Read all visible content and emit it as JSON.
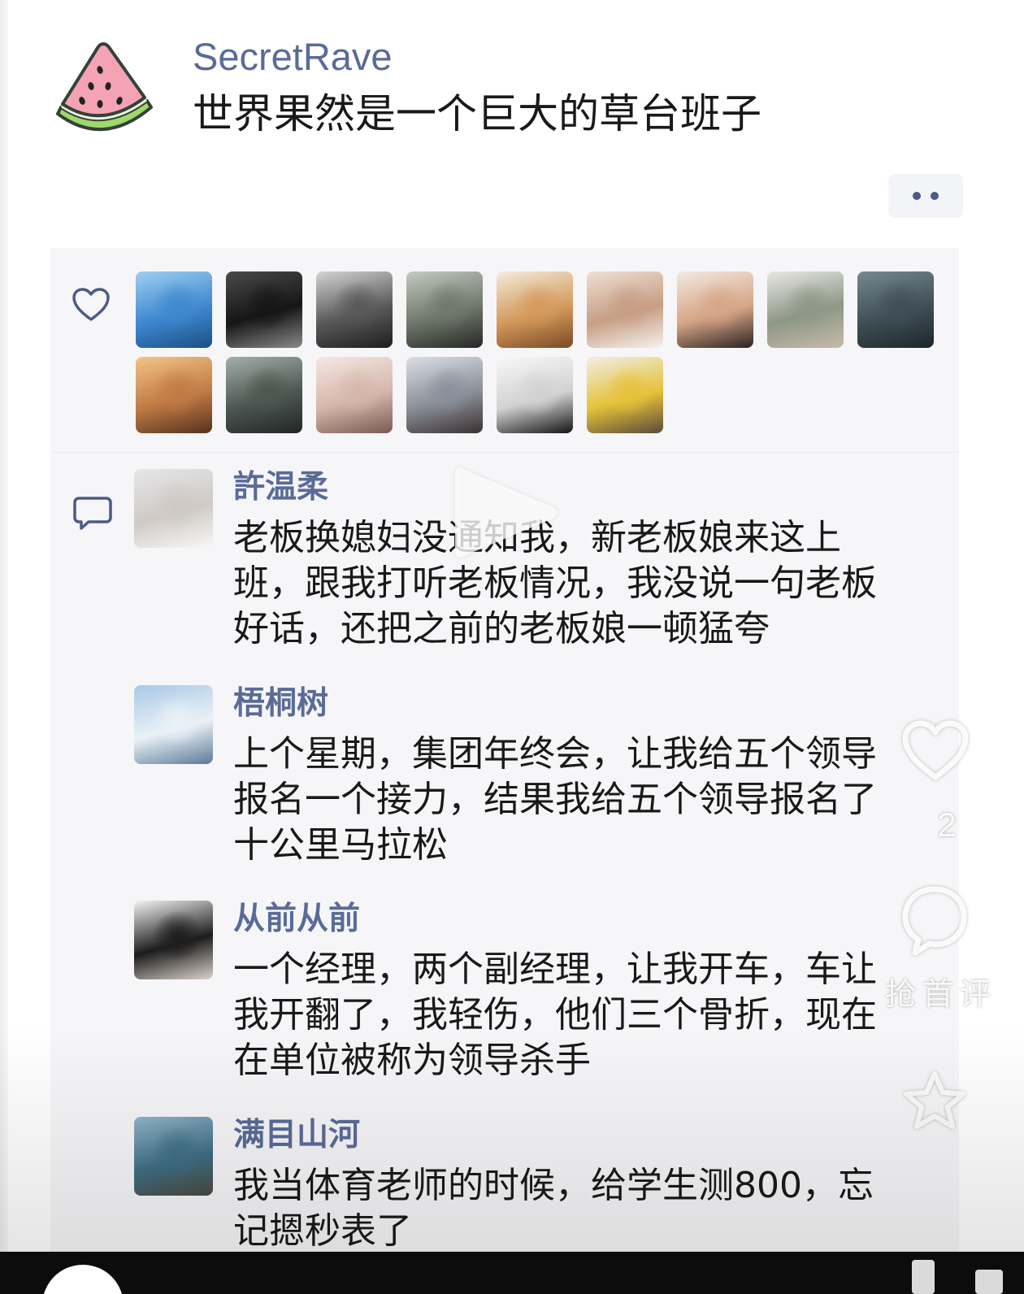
{
  "post": {
    "author": "SecretRave",
    "text": "世界果然是一个巨大的草台班子",
    "avatar_icon": "watermelon-icon"
  },
  "colors": {
    "name_blue": "#5a6b98",
    "body_text": "#191919",
    "panel_bg": "#f6f6f8",
    "icon_stroke": "#4c5b85"
  },
  "likes": {
    "icon": "heart-icon",
    "avatars": [
      {
        "colors": [
          "#9fcff0",
          "#3f88d0",
          "#1c4f86"
        ]
      },
      {
        "colors": [
          "#4a4a4a",
          "#161616",
          "#8a8a8a"
        ]
      },
      {
        "colors": [
          "#d4d4d4",
          "#595959",
          "#1e1e1e"
        ]
      },
      {
        "colors": [
          "#c3cbc0",
          "#6f786a",
          "#262626"
        ]
      },
      {
        "colors": [
          "#f3ebdc",
          "#d49a5c",
          "#7a4a25"
        ]
      },
      {
        "colors": [
          "#eedfd3",
          "#c79e85",
          "#f6f1ec"
        ]
      },
      {
        "colors": [
          "#f2e9e2",
          "#d6a586",
          "#2a2220"
        ]
      },
      {
        "colors": [
          "#e8e8e4",
          "#8e9786",
          "#c6bba9"
        ]
      },
      {
        "colors": [
          "#75898f",
          "#3f4f55",
          "#1d272b"
        ]
      },
      {
        "colors": [
          "#f4c486",
          "#c07a44",
          "#55321e"
        ]
      },
      {
        "colors": [
          "#a3b0a9",
          "#4d5752",
          "#212624"
        ]
      },
      {
        "colors": [
          "#f4e8e3",
          "#d6b6ab",
          "#7a5a50"
        ]
      },
      {
        "colors": [
          "#dcdfe4",
          "#8a8f99",
          "#3a3030"
        ]
      },
      {
        "colors": [
          "#f8f8f8",
          "#d2d2d2",
          "#141414"
        ]
      },
      {
        "colors": [
          "#f1eee7",
          "#e5c23a",
          "#5a4a3a"
        ]
      }
    ]
  },
  "comments_icon": "comment-bubble-icon",
  "comments": [
    {
      "name": "許温柔",
      "text": "老板换媳妇没通知我，新老板娘来这上班，跟我打听老板情况，我没说一句老板好话，还把之前的老板娘一顿猛夸",
      "avatar_colors": [
        "#e6e6e8",
        "#cfcac5",
        "#f7f7f7"
      ]
    },
    {
      "name": "梧桐树",
      "text": "上个星期，集团年终会，让我给五个领导报名一个接力，结果我给五个领导报名了十公里马拉松",
      "avatar_colors": [
        "#a7c9e6",
        "#eaf1f6",
        "#5b7a97"
      ]
    },
    {
      "name": "从前从前",
      "text": "一个经理，两个副经理，让我开车，车让我开翻了，我轻伤，他们三个骨折，现在在单位被称为领导杀手",
      "avatar_colors": [
        "#f3f3f3",
        "#1c1c1c",
        "#dcd3cb"
      ]
    },
    {
      "name": "满目山河",
      "text": "我当体育老师的时候，给学生测800，忘记摁秒表了",
      "avatar_colors": [
        "#93b6cb",
        "#3f6f86",
        "#4a4a3e"
      ]
    }
  ],
  "overlay": {
    "play_icon": "play-icon",
    "like_count": "2",
    "comment_label": "抢首评",
    "icons": [
      "heart-outline-icon",
      "comment-icon",
      "star-icon"
    ]
  }
}
